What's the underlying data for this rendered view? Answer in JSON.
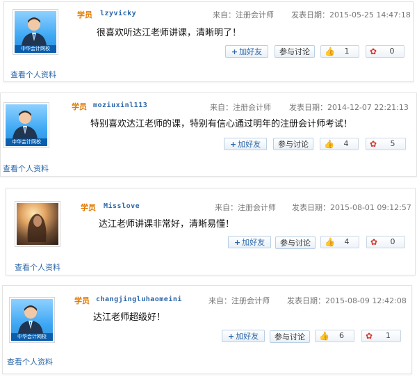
{
  "comments": [
    {
      "role": "学员",
      "username": "lzyvicky",
      "source": "来自：注册会计师",
      "date": "发表日期：2015-05-25 14:47:18",
      "message": "很喜欢听达江老师讲课，清晰明了！",
      "add_friend": "加好友",
      "discuss": "参与讨论",
      "likes": "1",
      "flowers": "0",
      "view_profile": "查看个人资料",
      "avatar_caption": "中华会计网校"
    },
    {
      "role": "学员",
      "username": "moziuxinl113",
      "source": "来自：注册会计师",
      "date": "发表日期：2014-12-07 22:21:13",
      "message": "特别喜欢达江老师的课，特别有信心通过明年的注册会计师考试！",
      "add_friend": "加好友",
      "discuss": "参与讨论",
      "likes": "4",
      "flowers": "5",
      "view_profile": "查看个人资料",
      "avatar_caption": "中华会计网校"
    },
    {
      "role": "学员",
      "username": "Misslove",
      "source": "来自：注册会计师",
      "date": "发表日期：2015-08-01 09:12:57",
      "message": "达江老师讲课非常好，清晰易懂！",
      "add_friend": "加好友",
      "discuss": "参与讨论",
      "likes": "4",
      "flowers": "0",
      "view_profile": "查看个人资料"
    },
    {
      "role": "学员",
      "username": "changjingluhaomeini",
      "source": "来自：注册会计师",
      "date": "发表日期：2015-08-09 12:42:08",
      "message": "达江老师超级好！",
      "add_friend": "加好友",
      "discuss": "参与讨论",
      "likes": "6",
      "flowers": "1",
      "view_profile": "查看个人资料",
      "avatar_caption": "中华会计网校"
    }
  ],
  "icons": {
    "like": "thumbs-up-icon",
    "flower": "flower-icon",
    "add": "plus-icon"
  },
  "colors": {
    "role": "#e07b00",
    "username": "#2b66a8",
    "link": "#2b66a8",
    "button_border": "#b8cfe4"
  }
}
